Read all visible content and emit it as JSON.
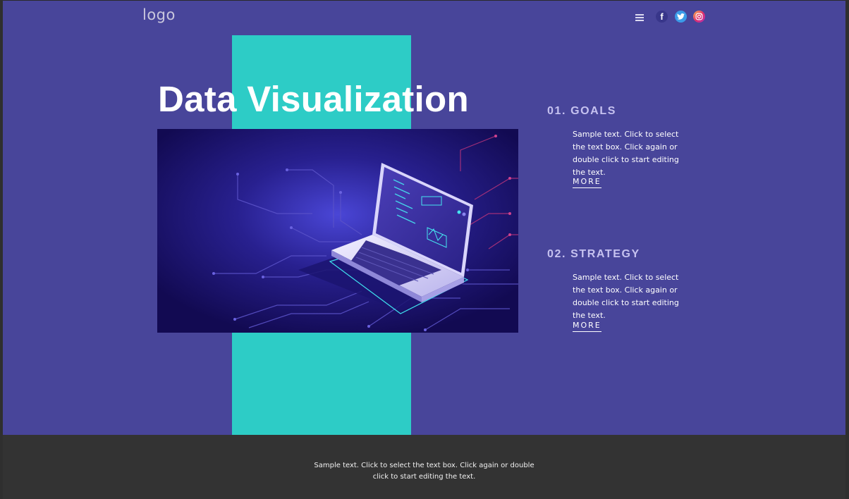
{
  "header": {
    "logo": "logo",
    "menu_icon": "hamburger-icon",
    "social": {
      "facebook": {
        "label": "f",
        "icon": "facebook-icon",
        "color": "#38368a"
      },
      "twitter": {
        "icon": "twitter-icon",
        "color": "#3b9be8"
      },
      "instagram": {
        "icon": "instagram-icon",
        "color": "#e1306c"
      }
    }
  },
  "hero": {
    "title": "Data Visualization",
    "illustration": "laptop-circuit-illustration",
    "colors": {
      "background": "#48459a",
      "accent": "#2dccc6"
    }
  },
  "sections": [
    {
      "heading": "01. GOALS",
      "text": "Sample text. Click to select the text box. Click again or double click to start editing the text.",
      "more": "MORE"
    },
    {
      "heading": "02. STRATEGY",
      "text": "Sample text. Click to select the text box. Click again or double click to start editing the text.",
      "more": "MORE"
    }
  ],
  "footer": {
    "text_line1": "Sample text. Click to select the text box. Click again or double",
    "text_line2": "click to start editing the text.",
    "color": "#333333"
  }
}
